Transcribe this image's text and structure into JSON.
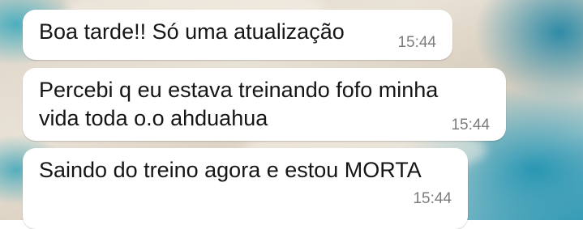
{
  "messages": [
    {
      "text": "Boa tarde!! Só uma atualização",
      "time": "15:44"
    },
    {
      "text": "Percebi q eu estava treinando fofo minha\nvida toda o.o ahduahua",
      "time": "15:44"
    },
    {
      "text": "Saindo do treino agora e estou MORTA",
      "time": "15:44"
    }
  ],
  "colors": {
    "bubble": "#ffffff",
    "text": "#161616",
    "timestamp": "#7c7c7c"
  }
}
